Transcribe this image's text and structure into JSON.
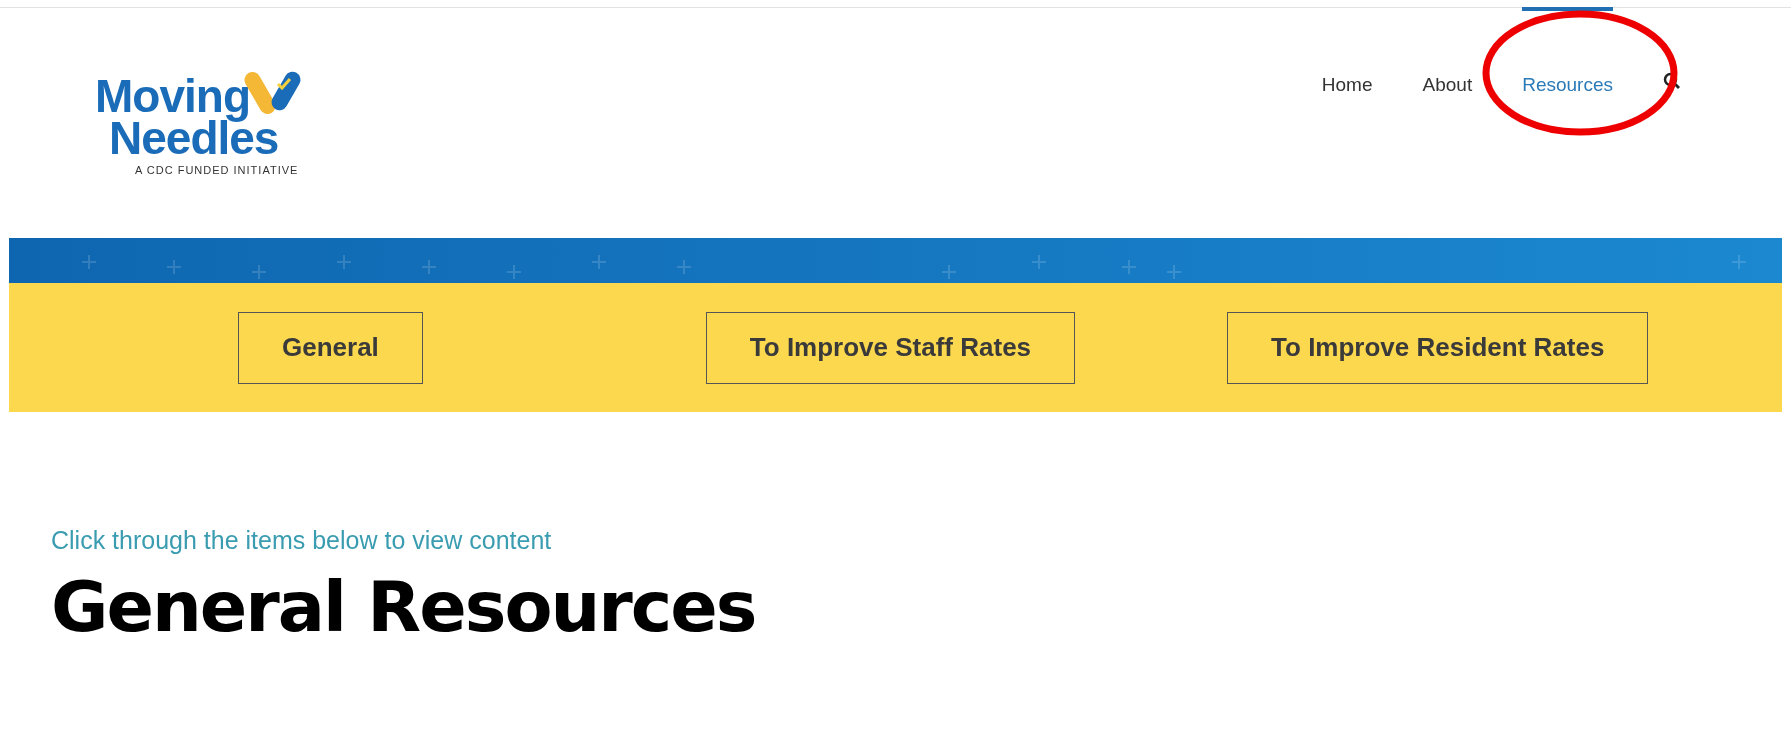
{
  "logo": {
    "line_1": "Moving",
    "line_2": "Needles",
    "tagline": "A CDC FUNDED INITIATIVE"
  },
  "nav": [
    {
      "label": "Home",
      "selected": false
    },
    {
      "label": "About",
      "selected": false
    },
    {
      "label": "Resources",
      "selected": true
    }
  ],
  "category_buttons": [
    "General",
    "To Improve Staff Rates",
    "To Improve Resident Rates"
  ],
  "intro": "Click through the items below to view content",
  "heading": "General Resources"
}
